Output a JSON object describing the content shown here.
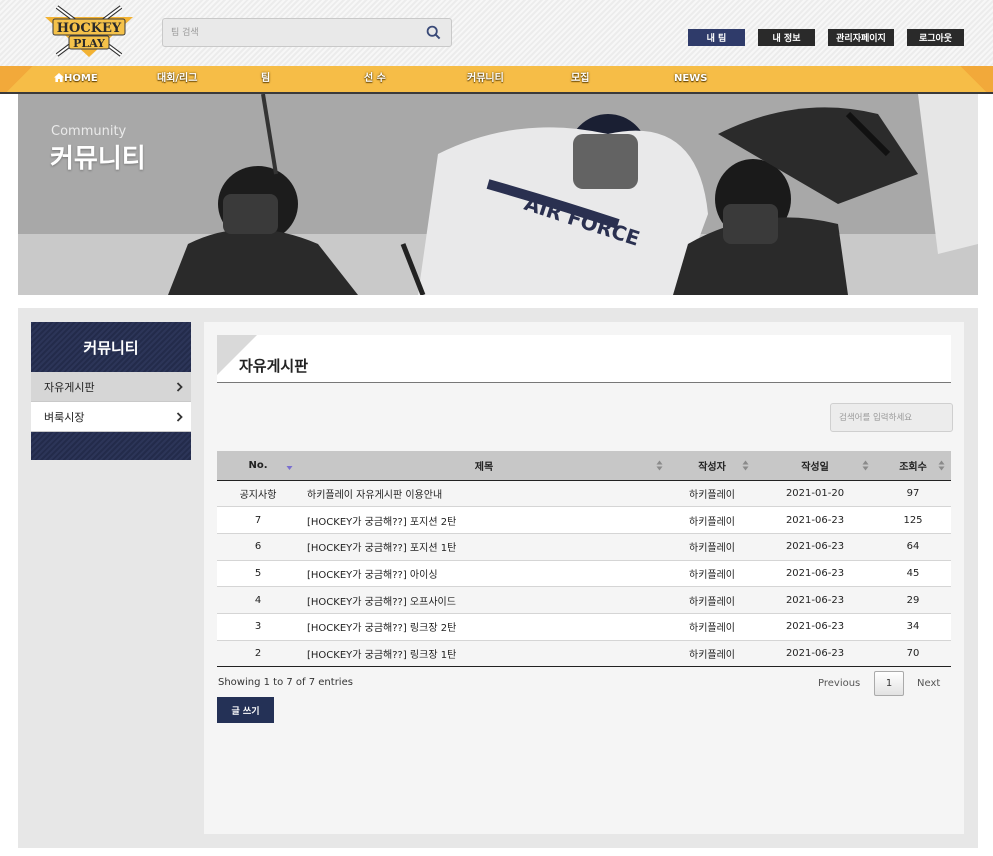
{
  "header": {
    "logo": {
      "line1": "HOCKEY",
      "line2": "PLAY"
    },
    "search_placeholder": "팀 검색",
    "buttons": [
      {
        "label": "내 팀",
        "color": "#2f3b6a"
      },
      {
        "label": "내 정보",
        "color": "#2a2a2a"
      },
      {
        "label": "관리자페이지",
        "color": "#2a2a2a"
      },
      {
        "label": "로그아웃",
        "color": "#2a2a2a"
      }
    ]
  },
  "nav": {
    "items": [
      "HOME",
      "대회/리그",
      "팀",
      "선 수",
      "커뮤니티",
      "모집",
      "NEWS"
    ]
  },
  "banner": {
    "subtitle": "Community",
    "title": "커뮤니티"
  },
  "sidebar": {
    "title": "커뮤니티",
    "items": [
      {
        "label": "자유게시판",
        "active": true
      },
      {
        "label": "벼룩시장",
        "active": false
      }
    ]
  },
  "board": {
    "title": "자유게시판",
    "search_placeholder": "검색어를 입력하세요",
    "columns": [
      "No.",
      "제목",
      "작성자",
      "작성일",
      "조회수"
    ],
    "rows": [
      {
        "no": "공지사항",
        "title": "하키플레이 자유게시판 이용안내",
        "author": "하키플레이",
        "date": "2021-01-20",
        "views": "97"
      },
      {
        "no": "7",
        "title": "[HOCKEY가 궁금해??] 포지션 2탄",
        "author": "하키플레이",
        "date": "2021-06-23",
        "views": "125"
      },
      {
        "no": "6",
        "title": "[HOCKEY가 궁금해??] 포지션 1탄",
        "author": "하키플레이",
        "date": "2021-06-23",
        "views": "64"
      },
      {
        "no": "5",
        "title": "[HOCKEY가 궁금해??] 아이싱",
        "author": "하키플레이",
        "date": "2021-06-23",
        "views": "45"
      },
      {
        "no": "4",
        "title": "[HOCKEY가 궁금해??] 오프사이드",
        "author": "하키플레이",
        "date": "2021-06-23",
        "views": "29"
      },
      {
        "no": "3",
        "title": "[HOCKEY가 궁금해??] 링크장 2탄",
        "author": "하키플레이",
        "date": "2021-06-23",
        "views": "34"
      },
      {
        "no": "2",
        "title": "[HOCKEY가 궁금해??] 링크장 1탄",
        "author": "하키플레이",
        "date": "2021-06-23",
        "views": "70"
      }
    ],
    "info": "Showing 1 to 7 of 7 entries",
    "pagination": {
      "prev": "Previous",
      "page": "1",
      "next": "Next"
    },
    "write_label": "글 쓰기"
  }
}
